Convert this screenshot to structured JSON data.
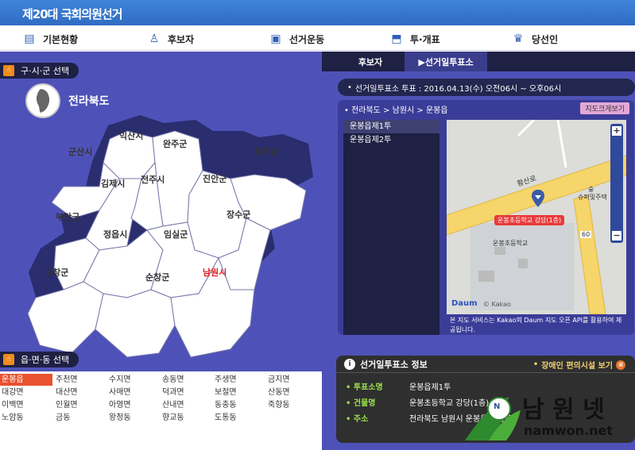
{
  "header": {
    "title": "제20대 국회의원선거"
  },
  "nav": [
    {
      "label": "기본현황",
      "icon": "document-icon"
    },
    {
      "label": "후보자",
      "icon": "person-icon"
    },
    {
      "label": "선거운동",
      "icon": "tv-icon"
    },
    {
      "label": "투·개표",
      "icon": "ballot-icon"
    },
    {
      "label": "당선인",
      "icon": "crown-icon"
    }
  ],
  "left": {
    "district_label": "구·시·군 선택",
    "province": "전라북도",
    "regions": [
      "익산시",
      "완주군",
      "군산시",
      "무주군",
      "김제시",
      "전주시",
      "진안군",
      "부안군",
      "장수군",
      "정읍시",
      "임실군",
      "고창군",
      "순창군",
      "남원시"
    ],
    "active_region": "남원시",
    "dong_label": "읍·면·동 선택",
    "dongs": [
      "운봉읍",
      "주천면",
      "수지면",
      "송동면",
      "주생면",
      "금지면",
      "대강면",
      "대산면",
      "사매면",
      "덕과면",
      "보절면",
      "산동면",
      "이백면",
      "인월면",
      "아영면",
      "산내면",
      "동충동",
      "죽항동",
      "노암동",
      "금동",
      "왕정동",
      "향교동",
      "도통동"
    ]
  },
  "right": {
    "tabs": [
      "후보자",
      "▶선거일투표소"
    ],
    "vote_period": "선거일투표소 투표 : 2016.04.13(수) 오전06시 ~ 오후06시",
    "breadcrumb": "전라북도 > 남원시 > 운봉읍",
    "map_zoom_button": "지도크게보기",
    "polls": [
      "운봉읍제1투",
      "운봉읍제2투"
    ],
    "map": {
      "marker_label": "운봉초등학교 강당(1층)",
      "school_label": "운봉초등학교",
      "road_label": "황산로",
      "shop_label": "슈퍼및주택",
      "shop_label2": "숲",
      "road_number": "60",
      "brand": "Daum",
      "brand2": "© Kakao"
    },
    "map_note": "본 지도 서비스는 Kakao의 Daum 지도 오픈 API를 활용하여 제공됩니다.",
    "info": {
      "title": "선거일투표소 정보",
      "more": "장애인 편의시설 보기",
      "rows": [
        {
          "k": "투표소명",
          "v": "운봉읍제1투"
        },
        {
          "k": "건물명",
          "v": "운봉초등학교 강당(1층)"
        },
        {
          "k": "주소",
          "v": "전라북도 남원시 운봉읍 운봉로"
        }
      ]
    }
  },
  "watermark": {
    "text": "남 원 넷",
    "url": "namwon.net",
    "badge": "N"
  },
  "colors": {
    "panel": "#4e52b8",
    "accent": "#e8522e",
    "dark": "#1e2044"
  }
}
